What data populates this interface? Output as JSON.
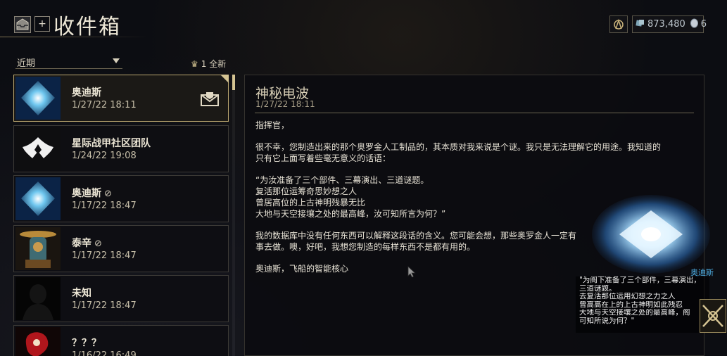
{
  "header": {
    "title": "收件箱",
    "add_label": "+",
    "credits": "873,480",
    "platinum": "6"
  },
  "filter": {
    "selected": "近期",
    "new_count": "1 全新"
  },
  "messages": [
    {
      "sender": "奥迪斯",
      "date": "1/27/22 18:11",
      "attachment": false,
      "selected": true
    },
    {
      "sender": "星际战甲社区团队",
      "date": "1/24/22 19:08",
      "attachment": false
    },
    {
      "sender": "奥迪斯",
      "date": "1/17/22 18:47",
      "attachment": true
    },
    {
      "sender": "泰辛",
      "date": "1/17/22 18:47",
      "attachment": true
    },
    {
      "sender": "未知",
      "date": "1/17/22 18:47",
      "attachment": false
    },
    {
      "sender": "？？？",
      "date": "1/16/22 16:49",
      "attachment": false
    }
  ],
  "message": {
    "title": "神秘电波",
    "date": "1/27/22 18:11",
    "greeting": "指挥官，",
    "para1_line1": "很不幸，您制造出来的那个奥罗金人工制品的，其本质对我来说是个谜。我只是无法理解它的用途。我知道的",
    "para1_line2": "只有它上面写着些毫无意义的话语：",
    "quote_line1": "“为汝准备了三个部件、三幕演出、三道谜题。",
    "quote_line2": "复活那位运筹奇思妙想之人",
    "quote_line3": "曾居高位的上古神明残暴无比",
    "quote_line4": "大地与天空接壤之处的最高峰，汝可知所言为何？”",
    "para3_line1": "我的数据库中没有任何东西可以解释这段话的含义。您可能会想，那些奥罗金人一定有",
    "para3_line2": "事去做。噢，好吧，我想您制造的每样东西不是都有用的。",
    "signoff": "奥迪斯，飞船的智能核心"
  },
  "transmission": {
    "speaker": "奥迪斯",
    "line1": "\"为阁下准备了三个部件，三幕演出，",
    "line2": "三道谜题。",
    "line3": "去复活那位运用幻想之力之人",
    "line4": "曾高高在上的上古神明如此残忍",
    "line5": "大地与天空接壤之处的最高峰，阁",
    "line6": "可知所说为何？\""
  },
  "colors": {
    "accent_gold": "#d4c392",
    "speaker_blue": "#4fb0e6"
  }
}
